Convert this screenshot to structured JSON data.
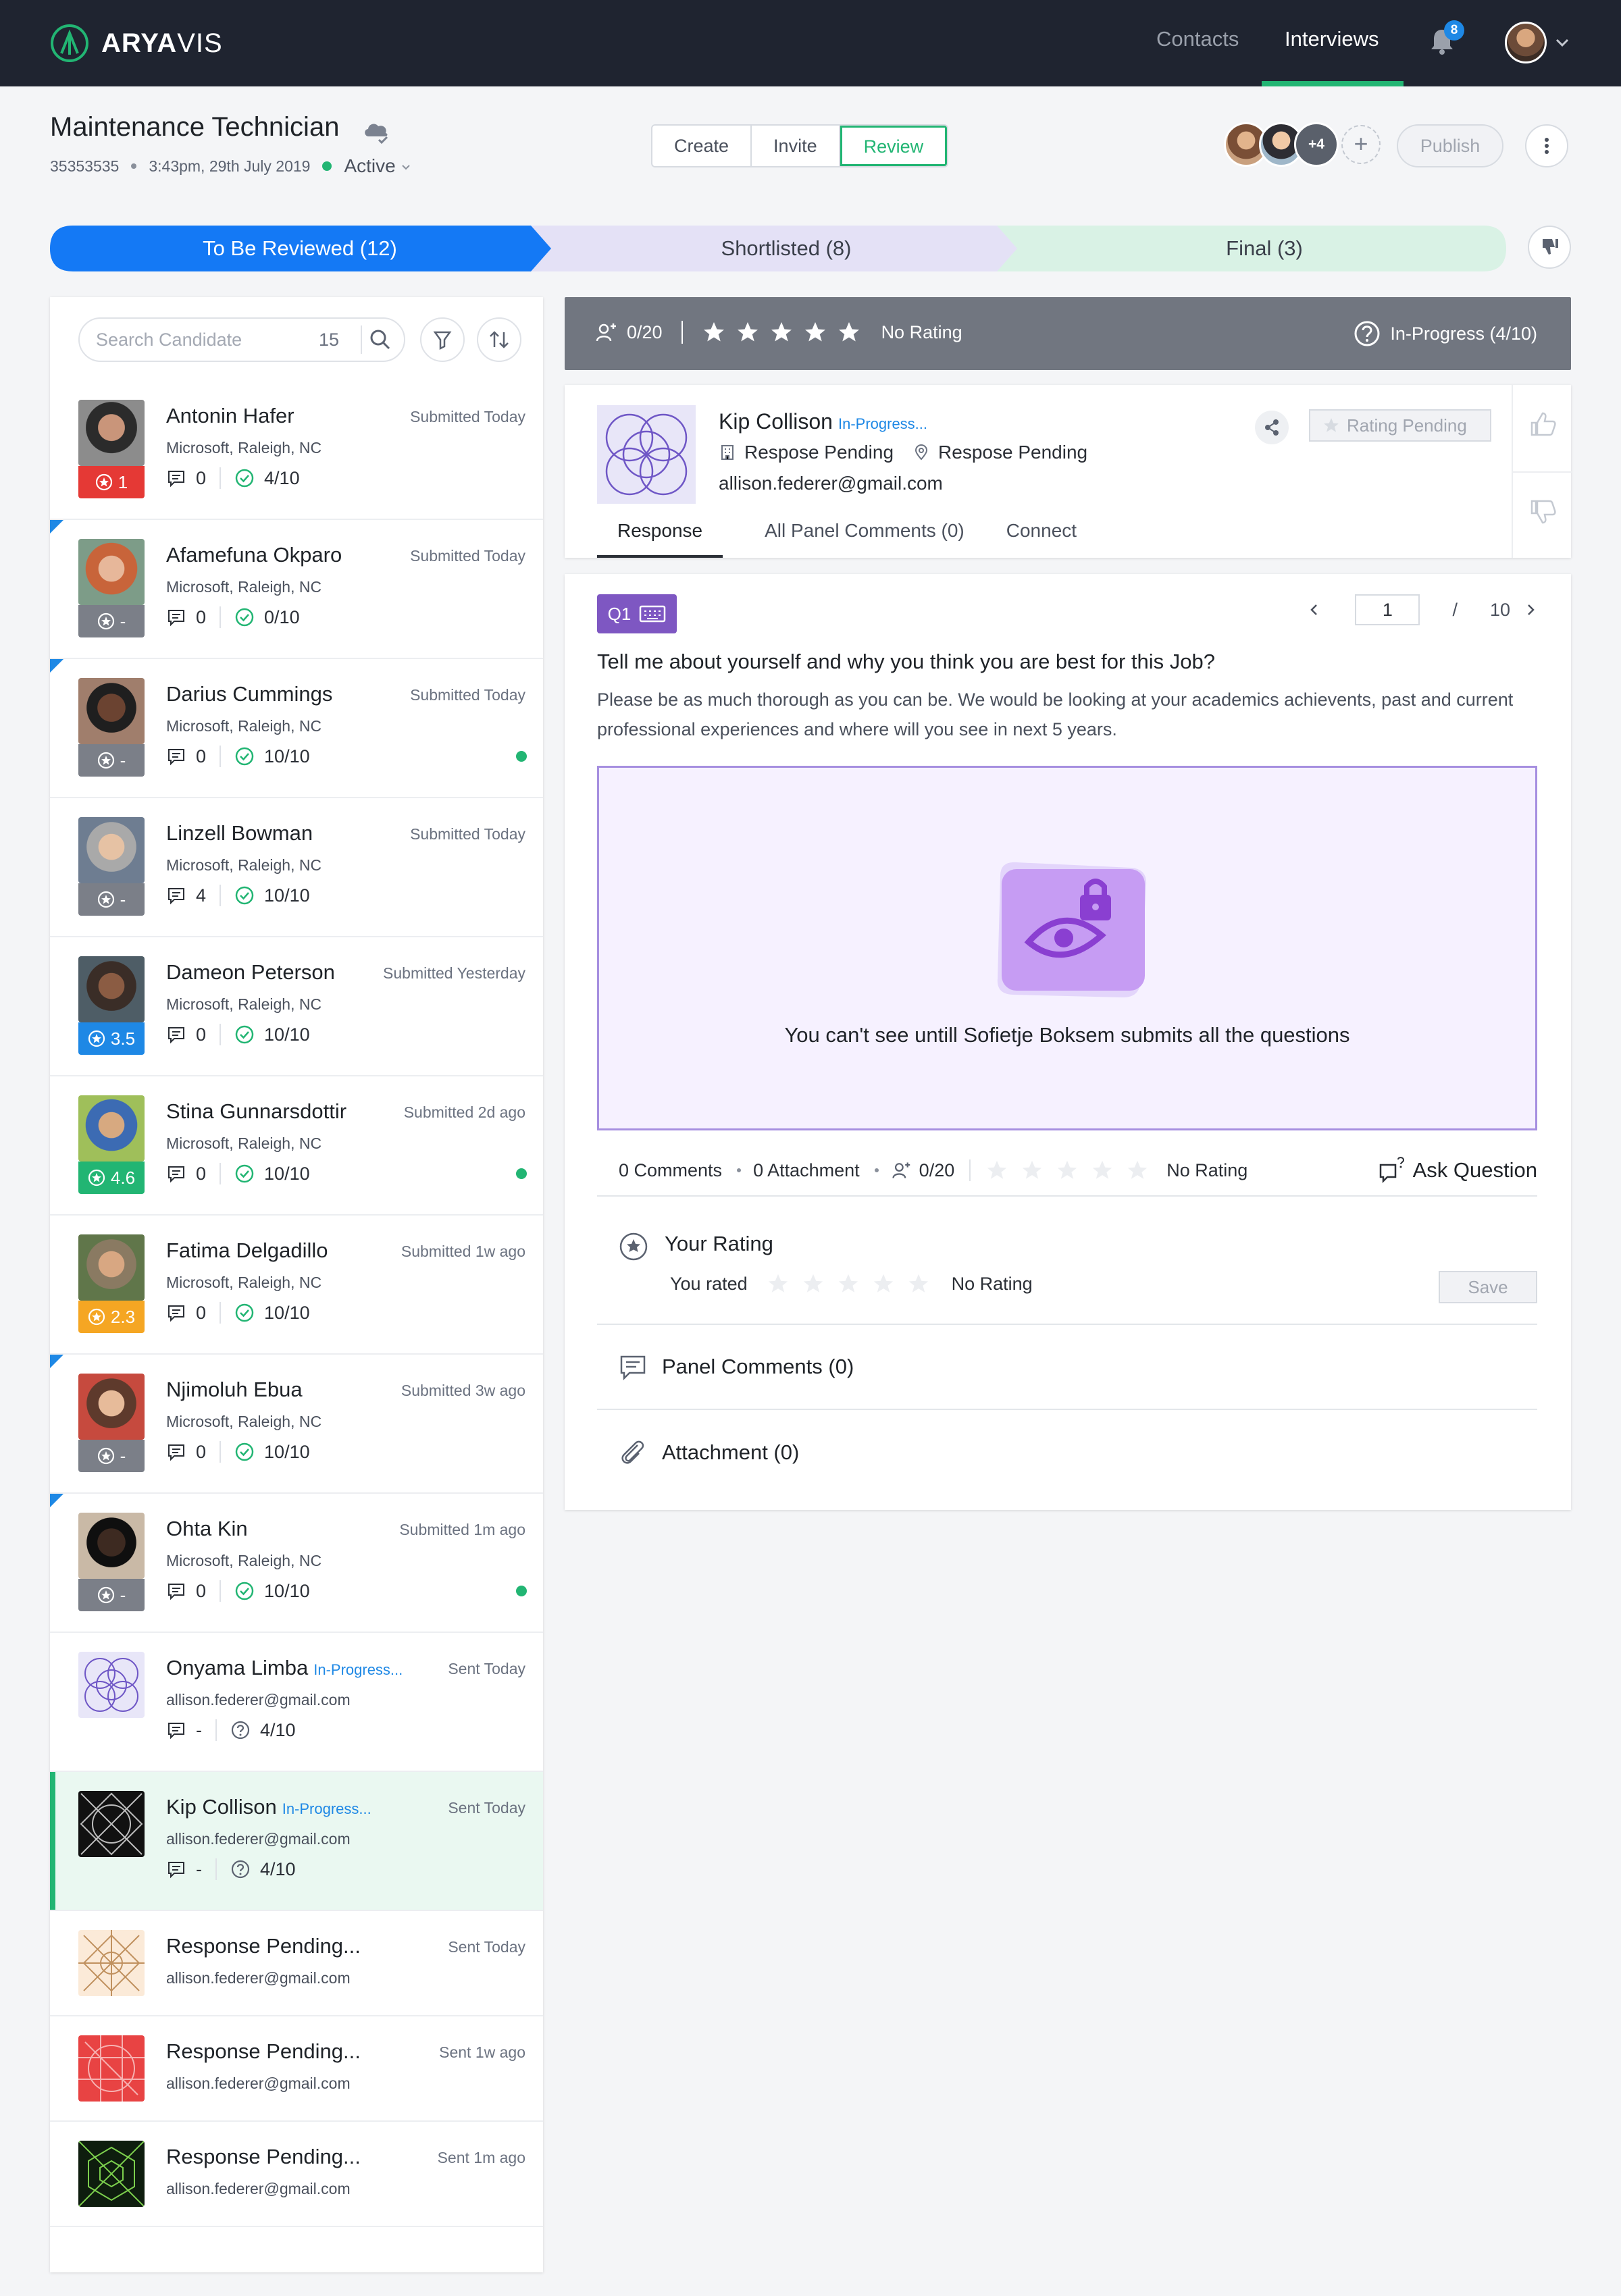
{
  "nav": {
    "brand_bold": "ARYA",
    "brand_light": "VIS",
    "links": [
      "Contacts",
      "Interviews"
    ],
    "active_link": "Interviews",
    "notification_count": "8",
    "accent": "#22b573"
  },
  "job": {
    "title": "Maintenance Technician",
    "id": "35353535",
    "datetime": "3:43pm, 29th July 2019",
    "status": "Active"
  },
  "mode_tabs": [
    "Create",
    "Invite",
    "Review"
  ],
  "active_mode": "Review",
  "team": {
    "more_label": "+4"
  },
  "publish_label": "Publish",
  "stages": [
    {
      "label": "To Be Reviewed (12)",
      "color": "#1479f5"
    },
    {
      "label": "Shortlisted (8)",
      "color": "#e4e1f6"
    },
    {
      "label": "Final (3)",
      "color": "#d9f2e5"
    }
  ],
  "search": {
    "placeholder": "Search Candidate",
    "count": "15"
  },
  "candidates": [
    {
      "name": "Antonin Hafer",
      "when": "Submitted Today",
      "company": "Microsoft, Raleigh, NC",
      "badge": "1",
      "badge_color": "#e53935",
      "comments": "0",
      "answered": "4/10",
      "flag": false,
      "online": false
    },
    {
      "name": "Afamefuna Okparo",
      "when": "Submitted Today",
      "company": "Microsoft, Raleigh, NC",
      "badge": "-",
      "badge_color": "#7b7f88",
      "comments": "0",
      "answered": "0/10",
      "flag": true,
      "online": false
    },
    {
      "name": "Darius Cummings",
      "when": "Submitted Today",
      "company": "Microsoft, Raleigh, NC",
      "badge": "-",
      "badge_color": "#7b7f88",
      "comments": "0",
      "answered": "10/10",
      "flag": true,
      "online": true
    },
    {
      "name": "Linzell Bowman",
      "when": "Submitted Today",
      "company": "Microsoft, Raleigh, NC",
      "badge": "-",
      "badge_color": "#7b7f88",
      "comments": "4",
      "answered": "10/10",
      "flag": false,
      "online": false
    },
    {
      "name": "Dameon Peterson",
      "when": "Submitted Yesterday",
      "company": "Microsoft, Raleigh, NC",
      "badge": "3.5",
      "badge_color": "#1e88e5",
      "comments": "0",
      "answered": "10/10",
      "flag": false,
      "online": false
    },
    {
      "name": "Stina Gunnarsdottir",
      "when": "Submitted 2d ago",
      "company": "Microsoft, Raleigh, NC",
      "badge": "4.6",
      "badge_color": "#22b573",
      "comments": "0",
      "answered": "10/10",
      "flag": false,
      "online": true
    },
    {
      "name": "Fatima Delgadillo",
      "when": "Submitted 1w ago",
      "company": "Microsoft, Raleigh, NC",
      "badge": "2.3",
      "badge_color": "#f5a623",
      "comments": "0",
      "answered": "10/10",
      "flag": false,
      "online": false
    },
    {
      "name": "Njimoluh Ebua",
      "when": "Submitted 3w ago",
      "company": "Microsoft, Raleigh, NC",
      "badge": "-",
      "badge_color": "#7b7f88",
      "comments": "0",
      "answered": "10/10",
      "flag": true,
      "online": false
    },
    {
      "name": "Ohta Kin",
      "when": "Submitted 1m ago",
      "company": "Microsoft, Raleigh, NC",
      "badge": "-",
      "badge_color": "#7b7f88",
      "comments": "0",
      "answered": "10/10",
      "flag": true,
      "online": true
    }
  ],
  "invited": [
    {
      "name": "Onyama Limba",
      "status": "In-Progress...",
      "when": "Sent Today",
      "email": "allison.federer@gmail.com",
      "comments": "-",
      "answered": "4/10"
    },
    {
      "name": "Kip Collison",
      "status": "In-Progress...",
      "when": "Sent Today",
      "email": "allison.federer@gmail.com",
      "comments": "-",
      "answered": "4/10"
    }
  ],
  "pending": [
    {
      "name": "Response Pending...",
      "when": "Sent Today",
      "email": "allison.federer@gmail.com"
    },
    {
      "name": "Response Pending...",
      "when": "Sent 1w ago",
      "email": "allison.federer@gmail.com"
    },
    {
      "name": "Response Pending...",
      "when": "Sent 1m ago",
      "email": "allison.federer@gmail.com"
    }
  ],
  "rating_bar": {
    "raters": "0/20",
    "label": "No Rating",
    "progress": "In-Progress (4/10)"
  },
  "candidate": {
    "name": "Kip Collison",
    "status": "In-Progress...",
    "company": "Respose Pending",
    "location": "Respose Pending",
    "email": "allison.federer@gmail.com",
    "rating_pending": "Rating Pending",
    "tabs": [
      "Response",
      "All Panel Comments (0)",
      "Connect"
    ]
  },
  "question": {
    "tag": "Q1",
    "page": "1",
    "sep": "/",
    "total": "10",
    "title": "Tell me about yourself and why you think you are best for this Job?",
    "description": "Please be as much thorough as you can be. We would be looking at your academics achievents, past and current professional experiences and where will you see in next 5 years.",
    "locked_text": "You can't see untill Sofietje Boksem submits all the questions",
    "comments": "0 Comments",
    "attachments": "0 Attachment",
    "raters": "0/20",
    "rating_label": "No Rating",
    "ask_label": "Ask Question"
  },
  "your_rating": {
    "title": "Your Rating",
    "you_rated": "You rated",
    "label": "No Rating",
    "save": "Save"
  },
  "panel_comments_label": "Panel Comments (0)",
  "attachment_label": "Attachment (0)"
}
